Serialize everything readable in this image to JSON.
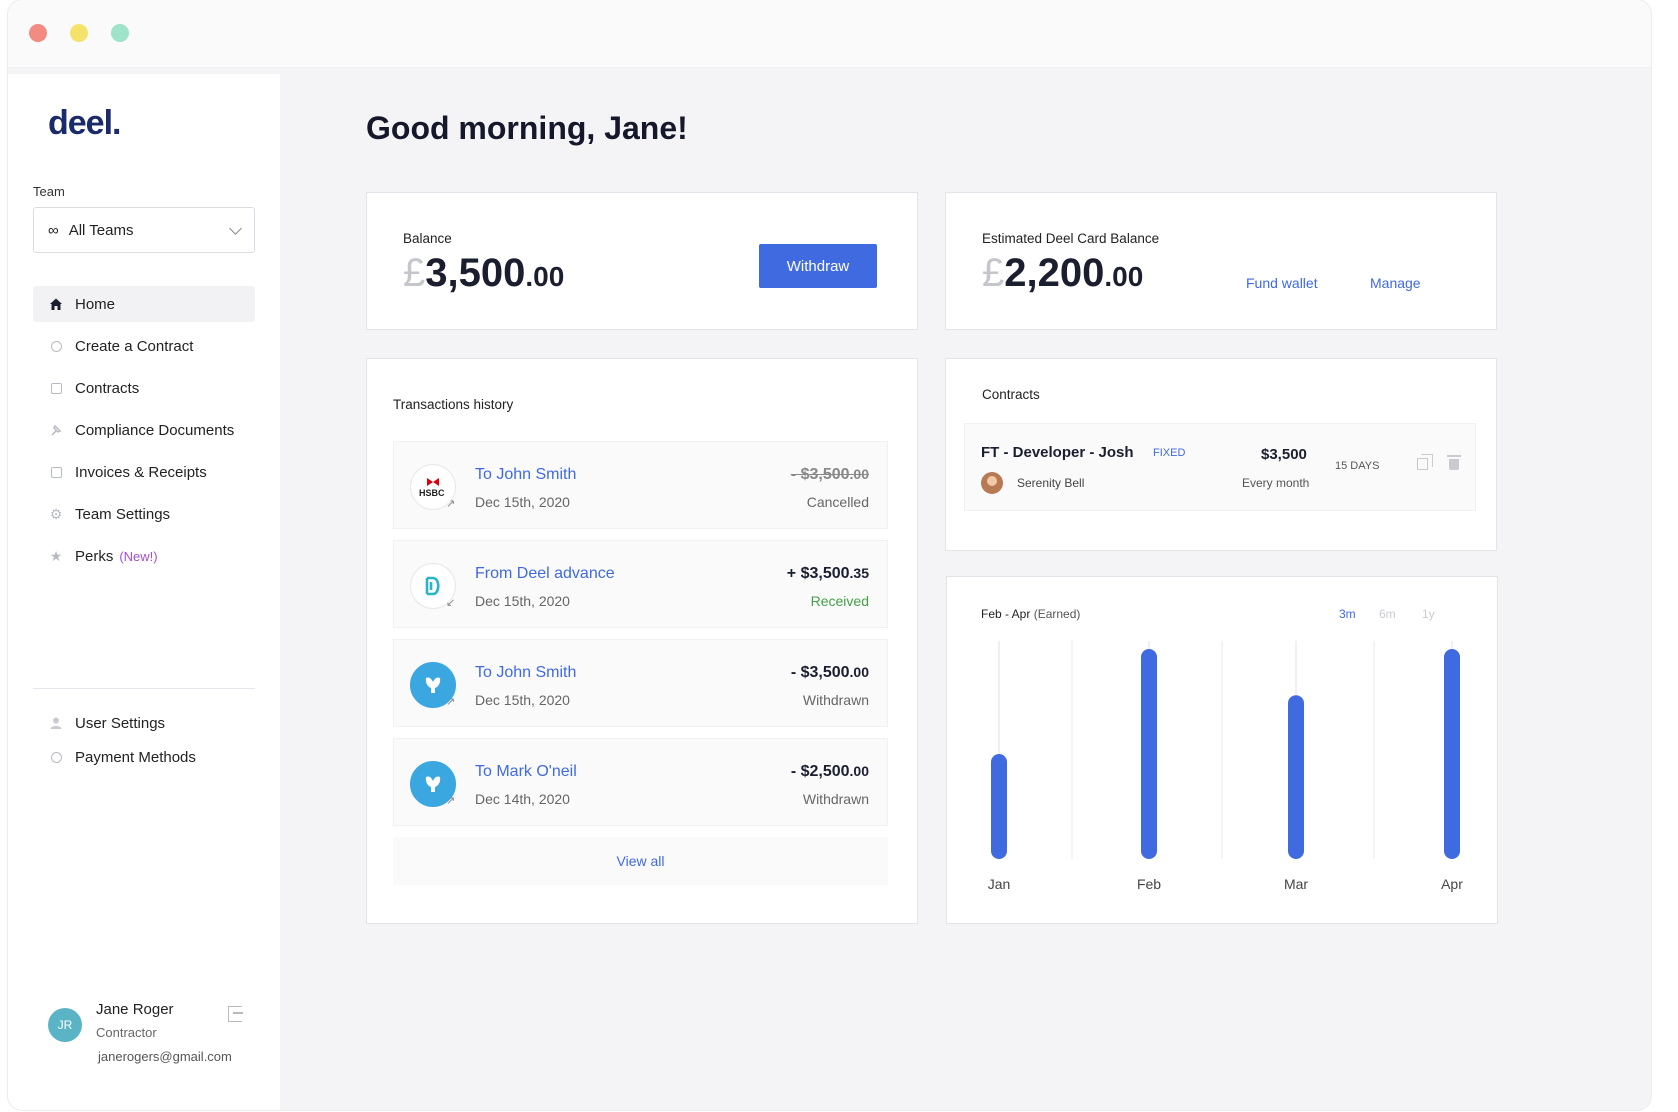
{
  "sidebar": {
    "logo": "deel.",
    "team_label": "Team",
    "team_select": {
      "icon": "infinity-icon",
      "value": "All Teams"
    },
    "items": [
      {
        "label": "Home",
        "icon": "home-icon",
        "active": true
      },
      {
        "label": "Create a Contract",
        "icon": "plus-circle-icon"
      },
      {
        "label": "Contracts",
        "icon": "document-icon"
      },
      {
        "label": "Compliance Documents",
        "icon": "pin-icon"
      },
      {
        "label": "Invoices & Receipts",
        "icon": "receipt-icon"
      },
      {
        "label": "Team Settings",
        "icon": "gear-icon"
      },
      {
        "label": "Perks",
        "badge": "(New!)",
        "icon": "star-icon"
      }
    ],
    "items2": [
      {
        "label": "User Settings",
        "icon": "user-icon"
      },
      {
        "label": "Payment Methods",
        "icon": "card-icon"
      }
    ],
    "user": {
      "initials": "JR",
      "name": "Jane Roger",
      "role": "Contractor",
      "email": "janerogers@gmail.com"
    }
  },
  "greeting": "Good morning, Jane!",
  "balance": {
    "title": "Balance",
    "currency": "£",
    "whole": "3,500",
    "decimal": ".00",
    "withdraw_label": "Withdraw"
  },
  "card_balance": {
    "title": "Estimated Deel Card Balance",
    "currency": "£",
    "whole": "2,200",
    "decimal": ".00",
    "fund_label": "Fund wallet",
    "manage_label": "Manage"
  },
  "transactions": {
    "title": "Transactions history",
    "items": [
      {
        "who": "To John Smith",
        "date": "Dec 15th, 2020",
        "amount": "- $3,500",
        "decimal": ".00",
        "status": "Cancelled",
        "logo": "hsbc-logo-icon"
      },
      {
        "who": "From Deel advance",
        "date": "Dec 15th, 2020",
        "amount": "+ $3,500",
        "decimal": ".35",
        "status": "Received",
        "logo": "deel-logo-icon"
      },
      {
        "who": "To John Smith",
        "date": "Dec 15th, 2020",
        "amount": "- $3,500",
        "decimal": ".00",
        "status": "Withdrawn",
        "logo": "barclays-logo-icon"
      },
      {
        "who": "To Mark O'neil",
        "date": "Dec 14th, 2020",
        "amount": "- $2,500",
        "decimal": ".00",
        "status": "Withdrawn",
        "logo": "barclays-logo-icon"
      }
    ],
    "view_all_label": "View all"
  },
  "contracts": {
    "title": "Contracts",
    "items": [
      {
        "title": "FT - Developer - Josh",
        "type": "FIXED",
        "person": "Serenity Bell",
        "amount": "$3,500",
        "frequency": "Every month",
        "days": "15 DAYS"
      }
    ]
  },
  "earnings": {
    "title": "Feb - Apr",
    "subtitle": "(Earned)",
    "ranges": [
      "3m",
      "6m",
      "1y"
    ],
    "selected_range": "3m"
  },
  "chart_data": {
    "type": "bar",
    "categories": [
      "Jan",
      "Feb",
      "Mar",
      "Apr"
    ],
    "values": [
      50,
      100,
      78,
      100
    ],
    "ylim": [
      0,
      100
    ],
    "grid": true,
    "bar_color": "#3f6ae0"
  },
  "colors": {
    "accent": "#3f6ae0",
    "brand": "#1b2a6b",
    "success": "#43a047",
    "perks_badge": "#a64dd0"
  }
}
